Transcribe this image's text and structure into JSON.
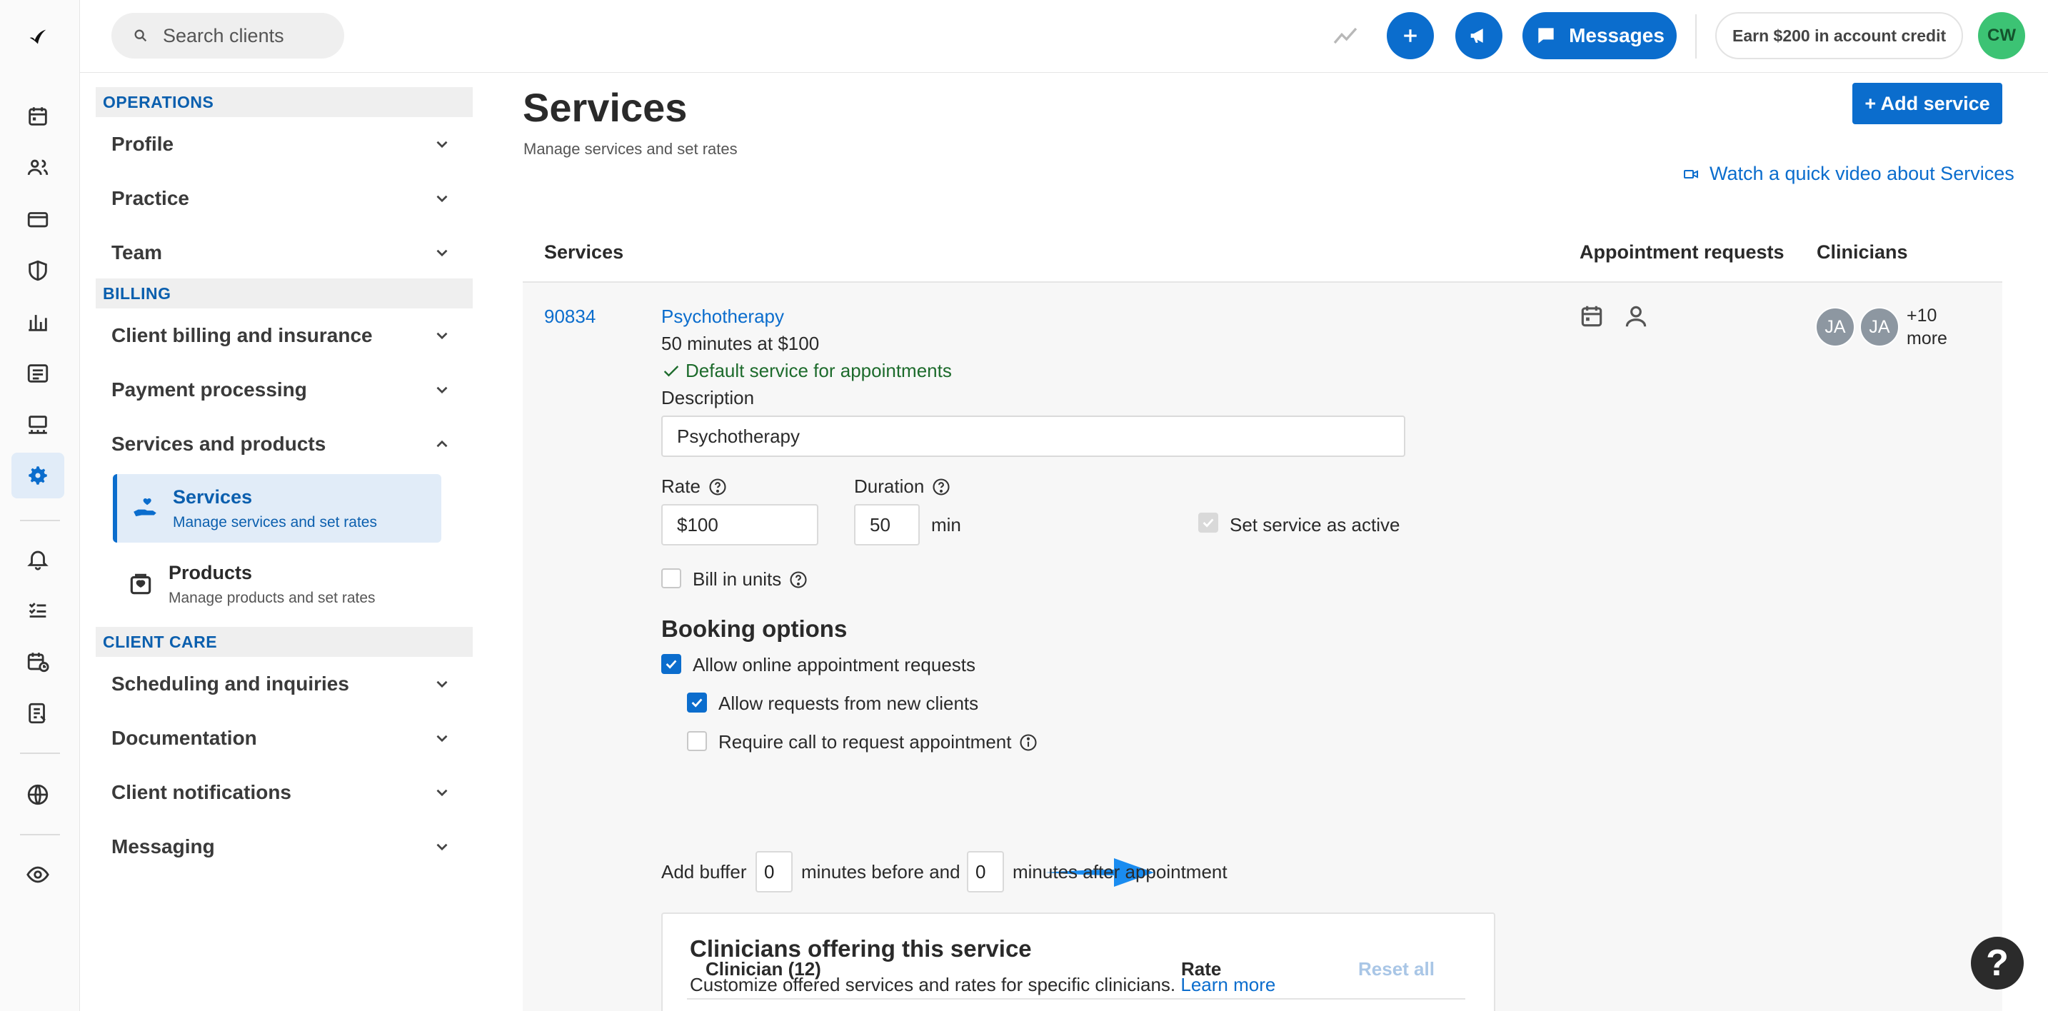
{
  "search": {
    "placeholder": "Search clients"
  },
  "topbar": {
    "messages_label": "Messages",
    "credit_label": "Earn $200 in account credit",
    "avatar_initials": "CW"
  },
  "sidenav": {
    "sections": [
      {
        "title": "OPERATIONS",
        "items": [
          "Profile",
          "Practice",
          "Team"
        ]
      },
      {
        "title": "BILLING",
        "items": [
          "Client billing and insurance",
          "Payment processing",
          "Services and products"
        ]
      },
      {
        "title": "CLIENT CARE",
        "items": [
          "Scheduling and inquiries",
          "Documentation",
          "Client notifications",
          "Messaging"
        ]
      }
    ],
    "sub_items": [
      {
        "title": "Services",
        "desc": "Manage services and set rates"
      },
      {
        "title": "Products",
        "desc": "Manage products and set rates"
      }
    ]
  },
  "page": {
    "title": "Services",
    "subtitle": "Manage services and set rates",
    "add_button": "+ Add service",
    "video_link": "Watch a quick video about Services"
  },
  "table": {
    "headers": {
      "services": "Services",
      "requests": "Appointment requests",
      "clinicians": "Clinicians"
    }
  },
  "service": {
    "code": "90834",
    "name": "Psychotherapy",
    "meta": "50 minutes at $100",
    "default_label": "Default service for appointments",
    "description_label": "Description",
    "description_value": "Psychotherapy",
    "rate_label": "Rate",
    "rate_value": "$100",
    "duration_label": "Duration",
    "duration_value": "50",
    "duration_unit": "min",
    "active_label": "Set service as active",
    "bill_units_label": "Bill in units",
    "clinician_avatars": [
      "JA",
      "JA"
    ],
    "clinician_more": "+10 more"
  },
  "booking": {
    "title": "Booking options",
    "allow_online": "Allow online appointment requests",
    "allow_new": "Allow requests from new clients",
    "require_call": "Require call to request appointment",
    "buffer_prefix": "Add buffer",
    "buffer_before": "0",
    "buffer_mid": "minutes before and",
    "buffer_after": "0",
    "buffer_suffix": "minutes after appointment"
  },
  "clinicians_card": {
    "title": "Clinicians offering this service",
    "subtitle": "Customize offered services and rates for specific clinicians.",
    "learn_more": "Learn more",
    "col_clinician": "Clinician (12)",
    "col_rate": "Rate",
    "reset_all": "Reset all"
  },
  "colors": {
    "accent": "#0b6dcd",
    "success": "#1d6b2c",
    "avatar_green": "#3cc374"
  },
  "icons": [
    "logo-icon",
    "calendar-icon",
    "clients-icon",
    "billing-card-icon",
    "shield-icon",
    "analytics-icon",
    "list-icon",
    "marketplace-icon",
    "gear-icon",
    "bell-icon",
    "tasks-icon",
    "calendar-clock-icon",
    "notes-icon",
    "globe-icon",
    "eye-icon"
  ]
}
